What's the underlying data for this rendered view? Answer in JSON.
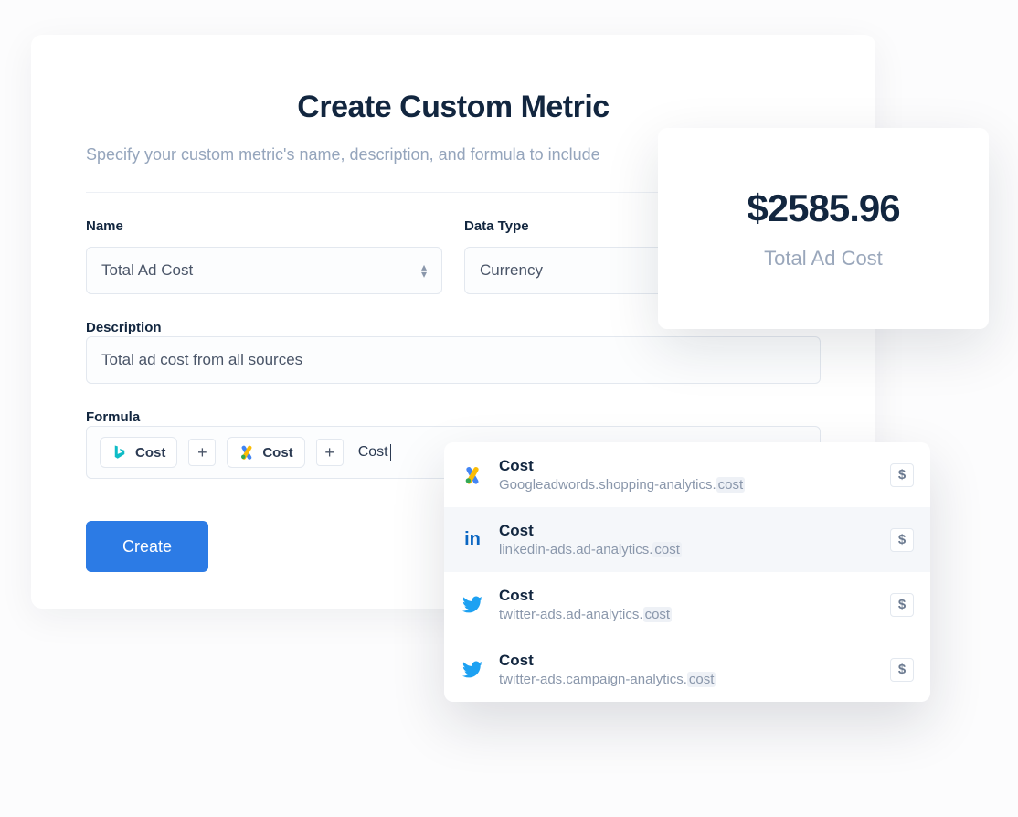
{
  "header": {
    "title": "Create Custom Metric",
    "subtitle": "Specify your custom metric's name, description, and formula to include"
  },
  "form": {
    "name_label": "Name",
    "name_value": "Total Ad Cost",
    "datatype_label": "Data Type",
    "datatype_value": "Currency",
    "description_label": "Description",
    "description_value": "Total ad cost from all sources",
    "formula_label": "Formula",
    "chips": [
      {
        "icon": "bing-ads-icon",
        "label": "Cost"
      },
      {
        "icon": "google-ads-icon",
        "label": "Cost"
      }
    ],
    "operator": "+",
    "typing_text": "Cost",
    "create_label": "Create"
  },
  "metric_card": {
    "value": "$2585.96",
    "name": "Total Ad Cost"
  },
  "suggestions": {
    "badge": "$",
    "items": [
      {
        "icon": "google-ads-icon",
        "title": "Cost",
        "path_prefix": "Googleadwords.shopping-analytics.",
        "path_frag": "cost",
        "hl": false
      },
      {
        "icon": "linkedin-icon",
        "title": "Cost",
        "path_prefix": "linkedin-ads.ad-analytics.",
        "path_frag": "cost",
        "hl": true
      },
      {
        "icon": "twitter-icon",
        "title": "Cost",
        "path_prefix": "twitter-ads.ad-analytics.",
        "path_frag": "cost",
        "hl": false
      },
      {
        "icon": "twitter-icon",
        "title": "Cost",
        "path_prefix": "twitter-ads.campaign-analytics.",
        "path_frag": "cost",
        "hl": false
      }
    ]
  }
}
